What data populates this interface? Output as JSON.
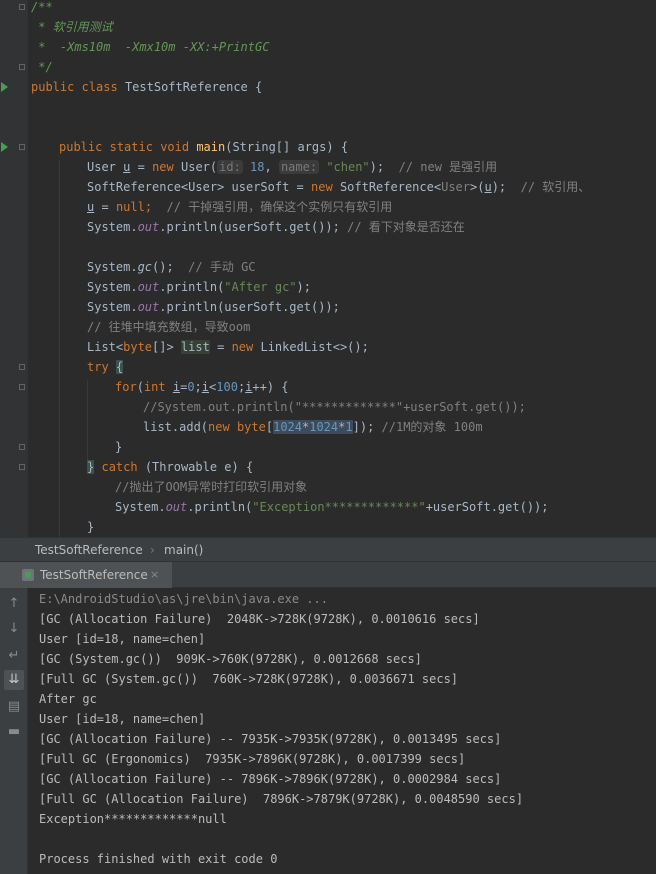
{
  "editor": {
    "doc_comment": [
      "/**",
      " * 软引用测试",
      " *  -Xms10m  -Xmx10m -XX:+PrintGC",
      " */"
    ],
    "class_decl": {
      "kw1": "public",
      "kw2": "class",
      "name": "TestSoftReference",
      "brace": "{"
    },
    "main_decl": {
      "kw1": "public",
      "kw2": "static",
      "kw3": "void",
      "name": "main",
      "params": "(String[] args) {"
    },
    "line_user": {
      "type": "User",
      "var": "u",
      "eq": "=",
      "kw": "new",
      "ctor": "User(",
      "hint_id": "id:",
      "arg_id": "18",
      "hint_name": "name:",
      "arg_name": "\"chen\"",
      "end": ");",
      "comment": "// new 是强引用"
    },
    "line_soft": {
      "type": "SoftReference<User>",
      "var": "userSoft",
      "eq": "=",
      "kw": "new",
      "ctor": "SoftReference<",
      "generic": "User",
      "ctor2": ">(",
      "arg": "u",
      "end": ");",
      "comment": "// 软引用、"
    },
    "line_null": {
      "var": "u",
      "rest": "=",
      "kw": "null",
      "end": ";",
      "comment": "// 干掉强引用，确保这个实例只有软引用"
    },
    "line_print1": {
      "pre": "System.",
      "out": "out",
      "mid": ".println(userSoft.get());",
      "comment": "// 看下对象是否还在"
    },
    "line_gc": {
      "pre": "System.",
      "gc": "gc",
      "mid": "();",
      "comment": "// 手动 GC"
    },
    "line_print2": {
      "pre": "System.",
      "out": "out",
      "mid": ".println(",
      "str": "\"After gc\"",
      "end": ");"
    },
    "line_print3": {
      "pre": "System.",
      "out": "out",
      "mid": ".println(userSoft.get());"
    },
    "line_comment_fill": "// 往堆中填充数组，导致oom",
    "line_list": {
      "pre": "List<",
      "kw": "byte",
      "mid": "[]>",
      "var": "list",
      "eq": "=",
      "kw2": "new",
      "ctor": "LinkedList<>();"
    },
    "line_try": {
      "kw": "try",
      "brace": "{"
    },
    "line_for": {
      "kw": "for",
      "open": "(",
      "kw2": "int",
      "v1": "i",
      "eq0": "=",
      "zero": "0",
      "semi1": ";",
      "v2": "i",
      "lt": "<",
      "hundred": "100",
      "semi2": ";",
      "v3": "i",
      "inc": "++) {"
    },
    "line_for_comment": "//System.out.println(\"*************\"+userSoft.get());",
    "line_add": {
      "pre": "list.add(",
      "kw": "new",
      "kw2": "byte",
      "br_open": "[",
      "n1": "1024",
      "op1": "*",
      "n2": "1024",
      "op2": "*",
      "n3": "1",
      "br_close": "]",
      "end": ");",
      "comment": "//1M的对象 100m"
    },
    "line_close1": "}",
    "line_catch": {
      "brace": "}",
      "kw": "catch",
      "rest": "(Throwable e) {"
    },
    "line_catch_comment": "//抛出了OOM异常时打印软引用对象",
    "line_print4": {
      "pre": "System.",
      "out": "out",
      "mid": ".println(",
      "str": "\"Exception*************\"",
      "end": "+userSoft.get());"
    },
    "line_close2": "}"
  },
  "breadcrumb": {
    "class": "TestSoftReference",
    "sep": "›",
    "method": "main()"
  },
  "run_panel": {
    "tab_label": "TestSoftReference",
    "tab_close": "×",
    "tools": [
      "arrow-up-icon",
      "arrow-down-icon",
      "soft-wrap-icon",
      "scroll-to-end-icon",
      "print-icon",
      "trash-icon"
    ],
    "console_lines": [
      "E:\\AndroidStudio\\as\\jre\\bin\\java.exe ...",
      "[GC (Allocation Failure)  2048K->728K(9728K), 0.0010616 secs]",
      "User [id=18, name=chen]",
      "[GC (System.gc())  909K->760K(9728K), 0.0012668 secs]",
      "[Full GC (System.gc())  760K->728K(9728K), 0.0036671 secs]",
      "After gc",
      "User [id=18, name=chen]",
      "[GC (Allocation Failure) -- 7935K->7935K(9728K), 0.0013495 secs]",
      "[Full GC (Ergonomics)  7935K->7896K(9728K), 0.0017399 secs]",
      "[GC (Allocation Failure) -- 7896K->7896K(9728K), 0.0002984 secs]",
      "[Full GC (Allocation Failure)  7896K->7879K(9728K), 0.0048590 secs]",
      "Exception*************null",
      "",
      "Process finished with exit code 0"
    ]
  },
  "colors": {
    "background": "#2b2b2b",
    "keyword": "#cc7832",
    "string": "#6a8759",
    "number": "#6897bb",
    "comment": "#808080",
    "doc_comment": "#629755",
    "field": "#9876aa",
    "run_marker": "#499c54"
  }
}
